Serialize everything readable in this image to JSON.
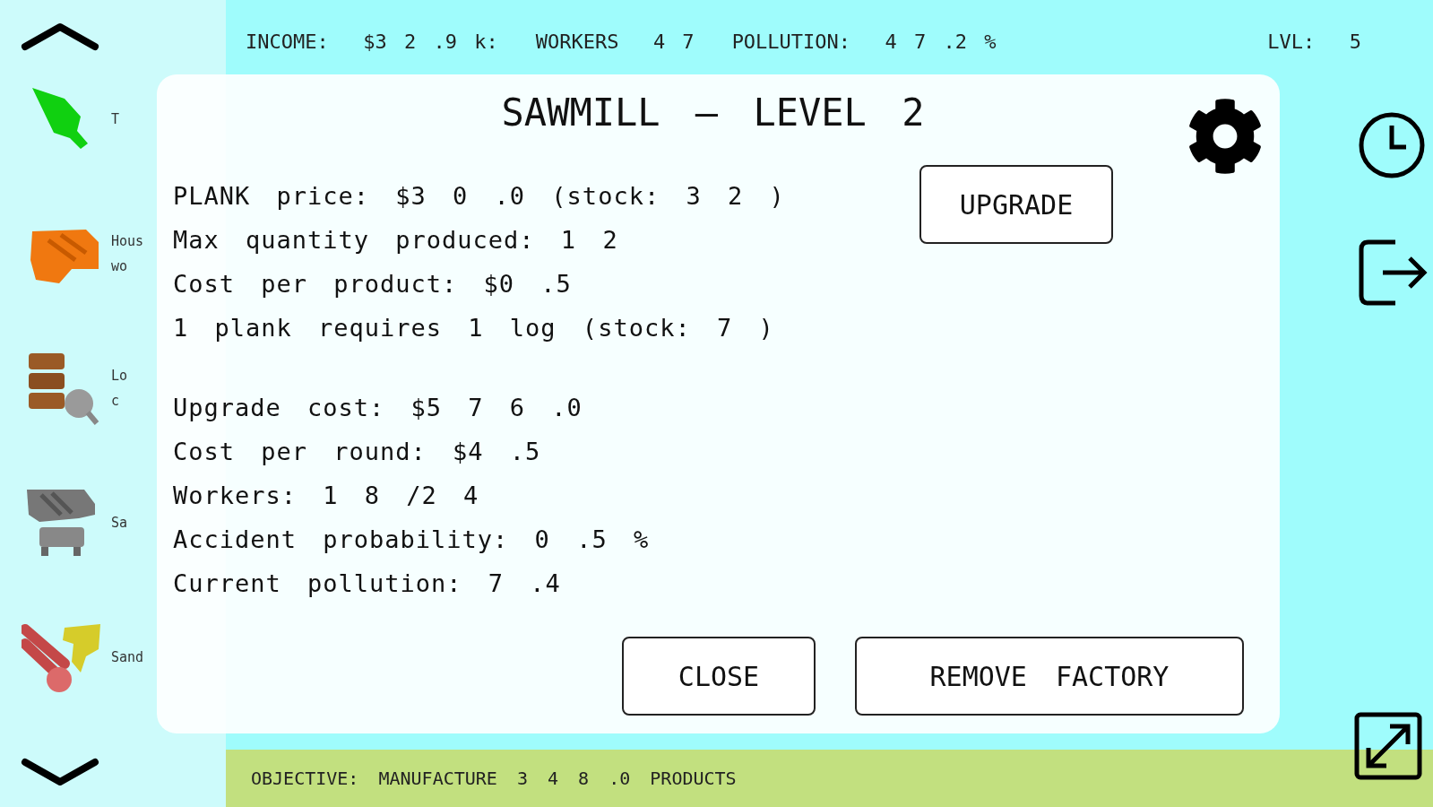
{
  "top_bar": {
    "stats": [
      {
        "label": "INCOME:",
        "value": "$3 2 .9 k:"
      },
      {
        "label": "WORKERS",
        "value": "4 7"
      },
      {
        "label": "POLLUTION:",
        "value": "4 7 .2 %"
      }
    ],
    "level": {
      "label": "LVL:",
      "value": "5"
    }
  },
  "sidebar": {
    "items": [
      {
        "kind": "tree",
        "label_lines": [
          "T"
        ]
      },
      {
        "kind": "house",
        "label_lines": [
          "Hous",
          "wo"
        ]
      },
      {
        "kind": "logging",
        "label_lines": [
          "Lo",
          "c"
        ]
      },
      {
        "kind": "sawmill",
        "label_lines": [
          "Sa"
        ]
      },
      {
        "kind": "sandmine",
        "label_lines": [
          "Sand"
        ]
      }
    ]
  },
  "dialog": {
    "title": "SAWMILL – LEVEL 2",
    "product_lines": [
      "PLANK price: $3 0 .0 (stock: 3 2 )",
      "Max quantity produced: 1 2",
      "Cost per product: $0 .5",
      "1 plank requires 1 log (stock: 7 )"
    ],
    "upgrade_lines": [
      "Upgrade cost: $5 7 6 .0",
      "Cost per round: $4 .5",
      "Workers: 1 8 /2 4",
      "Accident probability: 0 .5 %",
      "Current pollution: 7 .4"
    ],
    "upgrade_button": "UPGRADE",
    "close_button": "CLOSE",
    "remove_button": "REMOVE FACTORY"
  },
  "objective": "OBJECTIVE: MANUFACTURE 3 4 8 .0 PRODUCTS"
}
